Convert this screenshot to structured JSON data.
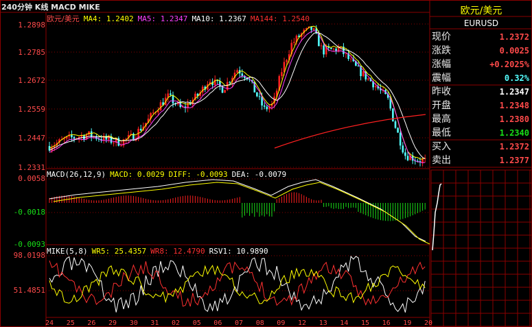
{
  "title": "240分钟 K线 MACD MIKE",
  "colors": {
    "up": "#ff2020",
    "down": "#54ffff",
    "grid": "#8b0000",
    "ma4": "#ffff00",
    "ma5": "#ff40ff",
    "ma10": "#ffffff",
    "ma144": "#ff2020",
    "axis_text": "#ff4a4a",
    "green": "#18e018",
    "cyan": "#54ffff"
  },
  "main_legend": {
    "symbol": "欧元/美元",
    "ma4": "MA4: 1.2402",
    "ma5": "MA5: 1.2347",
    "ma10": "MA10: 1.2367",
    "ma144": "MA144: 1.2540"
  },
  "price_axis": [
    "1.2898",
    "1.2785",
    "1.2672",
    "1.2559",
    "1.2447",
    "1.2331"
  ],
  "macd_legend": {
    "name": "MACD(26,12,9)",
    "macd": "MACD: 0.0029",
    "diff": "DIFF: -0.0093",
    "dea": "DEA: -0.0079"
  },
  "macd_axis": [
    "0.0058",
    "-0.0018",
    "-0.0093"
  ],
  "mike_legend": {
    "name": "MIKE(5,8)",
    "wr5": "WR5: 25.4357",
    "wr8": "WR8: 12.4790",
    "rsv1": "RSV1: 10.9890"
  },
  "mike_axis": [
    "98.0198",
    "51.4851"
  ],
  "x_labels": [
    "24",
    "25",
    "26",
    "29",
    "30",
    "31",
    "02",
    "05",
    "06",
    "07",
    "08",
    "09",
    "12",
    "13",
    "14",
    "15",
    "16",
    "19",
    "20"
  ],
  "quote_panel": {
    "title": "欧元/美元",
    "code": "EURUSD",
    "rows": [
      {
        "label": "现价",
        "value": "1.2372",
        "color": "#ff4a4a"
      },
      {
        "label": "涨跌",
        "value": "0.0025",
        "color": "#ff4a4a"
      },
      {
        "label": "涨幅",
        "value": "+0.2025%",
        "color": "#ff4a4a"
      },
      {
        "label": "震幅",
        "value": "0.32%",
        "color": "#54ffff"
      },
      {
        "label": "昨收",
        "value": "1.2347",
        "color": "#ffffff"
      },
      {
        "label": "开盘",
        "value": "1.2348",
        "color": "#ff4a4a"
      },
      {
        "label": "最高",
        "value": "1.2380",
        "color": "#ff4a4a"
      },
      {
        "label": "最低",
        "value": "1.2340",
        "color": "#18e018"
      },
      {
        "label": "买入",
        "value": "1.2372",
        "color": "#ff4a4a"
      },
      {
        "label": "卖出",
        "value": "1.2377",
        "color": "#ff4a4a"
      }
    ]
  }
}
